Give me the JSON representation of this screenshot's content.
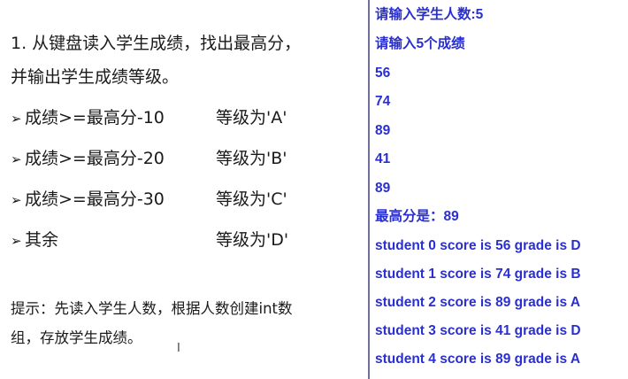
{
  "task": {
    "heading_line1": "1. 从键盘读入学生成绩，找出最高分，",
    "heading_line2": "并输出学生成绩等级。",
    "bullet_glyph": "➢",
    "rules": [
      {
        "condition": "成绩>=最高分-10",
        "grade": "等级为'A'"
      },
      {
        "condition": "成绩>=最高分-20",
        "grade": "等级为'B'"
      },
      {
        "condition": "成绩>=最高分-30",
        "grade": "等级为'C'"
      },
      {
        "condition": "其余",
        "grade": "等级为'D'"
      }
    ],
    "hint_line1": "提示：先读入学生人数，根据人数创建int数",
    "hint_line2": "组，存放学生成绩。",
    "cursor_glyph": "I"
  },
  "console": {
    "text_color": "#2a2fd0",
    "lines": [
      "请输入学生人数:5",
      "请输入5个成绩",
      "56",
      "74",
      "89",
      "41",
      "89",
      "最高分是：89",
      "student 0 score is 56  grade is D",
      "student 1 score is 74  grade is B",
      "student 2 score is 89  grade is A",
      "student 3 score is 41  grade is D",
      "student 4 score is 89  grade is A"
    ]
  }
}
